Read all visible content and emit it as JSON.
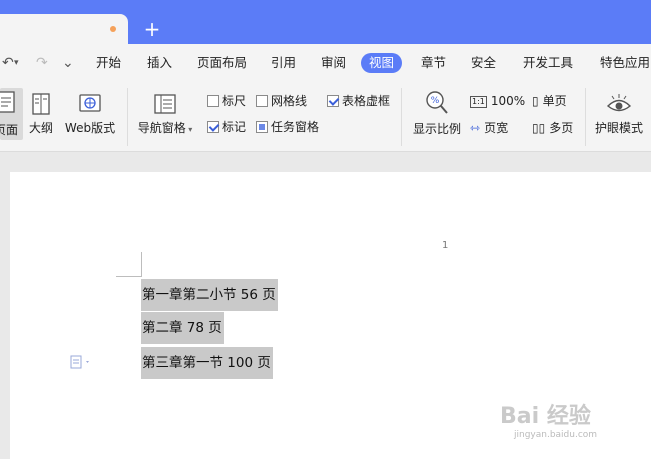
{
  "tab": {
    "new_tab": "+"
  },
  "quick_access": {
    "undo": "↶",
    "redo": "↷",
    "more": "⌄"
  },
  "menu": [
    "开始",
    "插入",
    "页面布局",
    "引用",
    "审阅",
    "视图",
    "章节",
    "安全",
    "开发工具",
    "特色应用"
  ],
  "menu_active": "视图",
  "ribbon": {
    "page_view": "页面",
    "outline": "大纲",
    "web_layout": "Web版式",
    "nav_pane": "导航窗格",
    "ruler": "标尺",
    "gridlines": "网格线",
    "table_gridlines": "表格虚框",
    "markup": "标记",
    "task_pane": "任务窗格",
    "zoom": "显示比例",
    "zoom_100": "100%",
    "page_width": "页宽",
    "one_page": "单页",
    "multi_page": "多页",
    "eye_protection": "护眼模式"
  },
  "checks": {
    "ruler": false,
    "gridlines": false,
    "table_gridlines": true,
    "markup": true,
    "task_pane": true
  },
  "document": {
    "page_number": "1",
    "lines": [
      "第一章第二小节 56 页",
      "第二章 78 页",
      "第三章第一节 100 页"
    ]
  },
  "watermark": {
    "main": "Bai 经验",
    "sub": "jingyan.baidu.com"
  },
  "colors": {
    "accent": "#5b7cf7",
    "selection": "#c9c9c9"
  }
}
